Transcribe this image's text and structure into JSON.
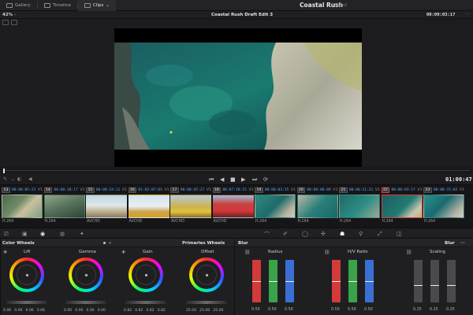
{
  "topbar": {
    "tabs": [
      {
        "label": "Gallery",
        "icon": "gallery-icon"
      },
      {
        "label": "Timeline",
        "icon": "timeline-icon"
      },
      {
        "label": "Clips",
        "icon": "clips-icon"
      }
    ],
    "project_title": "Coastal Rush",
    "project_status": "Edited"
  },
  "viewer": {
    "zoom": "42%",
    "clip_title": "Coastal Rush Draft Edit 3",
    "timecode_top": "00:00:03:17",
    "timecode_main": "01:00:47:07"
  },
  "clips": [
    {
      "num": "13",
      "tc": "00:00:05:23",
      "track": "V1",
      "fmt": "H.264",
      "thumb": "coast"
    },
    {
      "num": "14",
      "tc": "00:00:18:17",
      "track": "V1",
      "fmt": "H.264",
      "thumb": "rocks"
    },
    {
      "num": "15",
      "tc": "00:00:24:11",
      "track": "V1",
      "fmt": "AVCHD",
      "thumb": "beach"
    },
    {
      "num": "16",
      "tc": "01:02:07:03",
      "track": "V1",
      "fmt": "AVCHD",
      "thumb": "people"
    },
    {
      "num": "17",
      "tc": "00:00:45:27",
      "track": "V1",
      "fmt": "AVCHD",
      "thumb": "yellow"
    },
    {
      "num": "18",
      "tc": "00:07:28:15",
      "track": "V1",
      "fmt": "AVCHD",
      "thumb": "red"
    },
    {
      "num": "19",
      "tc": "00:00:03:15",
      "track": "V1",
      "fmt": "H.264",
      "thumb": "aerial"
    },
    {
      "num": "20",
      "tc": "00:00:06:09",
      "track": "V1",
      "fmt": "H.264",
      "thumb": "aerial2"
    },
    {
      "num": "21",
      "tc": "00:00:11:21",
      "track": "V1",
      "fmt": "H.264",
      "thumb": "aerial3"
    },
    {
      "num": "22",
      "tc": "00:00:03:17",
      "track": "V1",
      "fmt": "H.264",
      "thumb": "selected",
      "selected": true
    },
    {
      "num": "23",
      "tc": "00:00:15:02",
      "track": "V1",
      "fmt": "H.264",
      "thumb": "aerial4"
    }
  ],
  "panels": {
    "color_wheels": {
      "title": "Color Wheels",
      "mode": "Primaries Wheels",
      "wheels": [
        {
          "label": "Lift",
          "values": [
            "0.06",
            "0.06",
            "0.06",
            "0.06"
          ]
        },
        {
          "label": "Gamma",
          "values": [
            "0.00",
            "0.00",
            "0.00",
            "0.00"
          ]
        },
        {
          "label": "Gain",
          "values": [
            "0.82",
            "0.82",
            "0.82",
            "0.82"
          ]
        },
        {
          "label": "Offset",
          "values": [
            "25.00",
            "25.00",
            "25.00"
          ]
        }
      ]
    },
    "blur": {
      "title": "Blur",
      "mode": "Blur",
      "groups": [
        {
          "label": "Radius",
          "values": [
            "0.50",
            "0.50",
            "0.50"
          ],
          "colors": [
            "#d33a3a",
            "#3aa34a",
            "#3a6fd3"
          ]
        },
        {
          "label": "H/V Ratio",
          "values": [
            "0.50",
            "0.50",
            "0.50"
          ],
          "colors": [
            "#d33a3a",
            "#3aa34a",
            "#3a6fd3"
          ]
        },
        {
          "label": "Scaling",
          "values": [
            "0.25",
            "0.25",
            "0.25"
          ],
          "colors": [
            "#4a4a4e",
            "#4a4a4e",
            "#4a4a4e"
          ]
        }
      ]
    }
  }
}
